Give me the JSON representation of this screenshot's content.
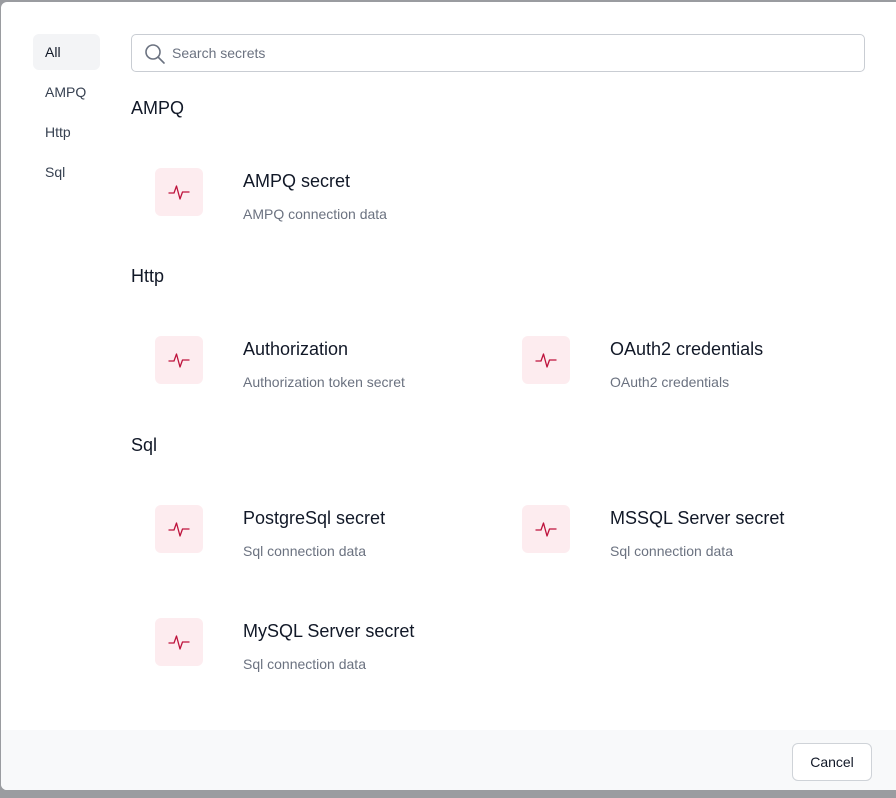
{
  "sidebar": {
    "items": [
      {
        "label": "All",
        "active": true
      },
      {
        "label": "AMPQ"
      },
      {
        "label": "Http"
      },
      {
        "label": "Sql"
      }
    ]
  },
  "search": {
    "placeholder": "Search secrets",
    "value": "",
    "icon": "search-icon"
  },
  "sections": [
    {
      "title": "AMPQ",
      "items": [
        {
          "icon": "pulse-icon",
          "title": "AMPQ secret",
          "description": "AMPQ connection data"
        }
      ]
    },
    {
      "title": "Http",
      "items": [
        {
          "icon": "pulse-icon",
          "title": "Authorization",
          "description": "Authorization token secret"
        },
        {
          "icon": "pulse-icon",
          "title": "OAuth2 credentials",
          "description": "OAuth2 credentials"
        }
      ]
    },
    {
      "title": "Sql",
      "items": [
        {
          "icon": "pulse-icon",
          "title": "PostgreSql secret",
          "description": "Sql connection data"
        },
        {
          "icon": "pulse-icon",
          "title": "MSSQL Server secret",
          "description": "Sql connection data"
        },
        {
          "icon": "pulse-icon",
          "title": "MySQL Server secret",
          "description": "Sql connection data"
        }
      ]
    }
  ],
  "footer": {
    "cancel_label": "Cancel"
  },
  "colors": {
    "accent": "#be123c",
    "tile_bg": "#fdecef",
    "footer_bg": "#f8f9fa"
  }
}
